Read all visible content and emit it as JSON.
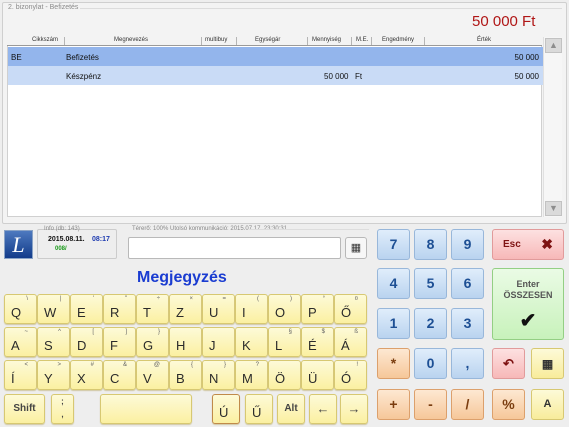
{
  "header": {
    "legend": "2. bizonylat - Befizetés",
    "total": "50 000 Ft"
  },
  "table": {
    "columns": [
      "Cikkszám",
      "Megnevezés",
      "multibuy",
      "Egységár",
      "Mennyiség",
      "M.E.",
      "Engedmény",
      "Érték"
    ],
    "rows": [
      {
        "code": "BE",
        "name": "Befizetés",
        "qty": "",
        "unit": "",
        "value": "50 000"
      },
      {
        "code": "",
        "name": "Készpénz",
        "qty": "50 000",
        "unit": "Ft",
        "value": "50 000"
      }
    ]
  },
  "info": {
    "label": "Info (db: 143)",
    "date": "2015.08.11.",
    "time": "08:17",
    "code": "008/"
  },
  "status": {
    "text": "Térerő: 100%  Utolsó kommunikáció: 2015.07.17. 23:30:31"
  },
  "remark": {
    "title": "Megjegyzés",
    "value": ""
  },
  "keyboard": {
    "row1": [
      {
        "m": "Q",
        "s": "\\"
      },
      {
        "m": "W",
        "s": "|"
      },
      {
        "m": "E",
        "s": "'"
      },
      {
        "m": "R",
        "s": "\""
      },
      {
        "m": "T",
        "s": "÷"
      },
      {
        "m": "Z",
        "s": "×"
      },
      {
        "m": "U",
        "s": "="
      },
      {
        "m": "I",
        "s": "("
      },
      {
        "m": "O",
        "s": ")"
      },
      {
        "m": "P",
        "s": "°"
      },
      {
        "m": "Ő",
        "s": "¤"
      }
    ],
    "row2": [
      {
        "m": "A",
        "s": "~"
      },
      {
        "m": "S",
        "s": "^"
      },
      {
        "m": "D",
        "s": "["
      },
      {
        "m": "F",
        "s": "]"
      },
      {
        "m": "G",
        "s": "}"
      },
      {
        "m": "H",
        "s": ""
      },
      {
        "m": "J",
        "s": ""
      },
      {
        "m": "K",
        "s": ""
      },
      {
        "m": "L",
        "s": "§"
      },
      {
        "m": "É",
        "s": "$"
      },
      {
        "m": "Á",
        "s": "ß"
      }
    ],
    "row3": [
      {
        "m": "Í",
        "s": "<"
      },
      {
        "m": "Y",
        "s": ">"
      },
      {
        "m": "X",
        "s": "#"
      },
      {
        "m": "C",
        "s": "&"
      },
      {
        "m": "V",
        "s": "@"
      },
      {
        "m": "B",
        "s": "{"
      },
      {
        "m": "N",
        "s": "}"
      },
      {
        "m": "M",
        "s": "?"
      },
      {
        "m": "Ö",
        "s": ""
      },
      {
        "m": "Ü",
        "s": ""
      },
      {
        "m": "Ó",
        "s": "!"
      }
    ],
    "shift": "Shift",
    "semi_top": ";",
    "semi_bot": ",",
    "u_acute": "Ú",
    "u_dbl": "Ű",
    "alt": "Alt"
  },
  "keypad": {
    "n7": "7",
    "n8": "8",
    "n9": "9",
    "n4": "4",
    "n5": "5",
    "n6": "6",
    "n1": "1",
    "n2": "2",
    "n3": "3",
    "star": "*",
    "n0": "0",
    "comma": ",",
    "plus": "+",
    "minus": "-",
    "slash": "/",
    "percent": "%",
    "esc": "Esc",
    "enter_line1": "Enter",
    "enter_line2": "ÖSSZESEN"
  }
}
